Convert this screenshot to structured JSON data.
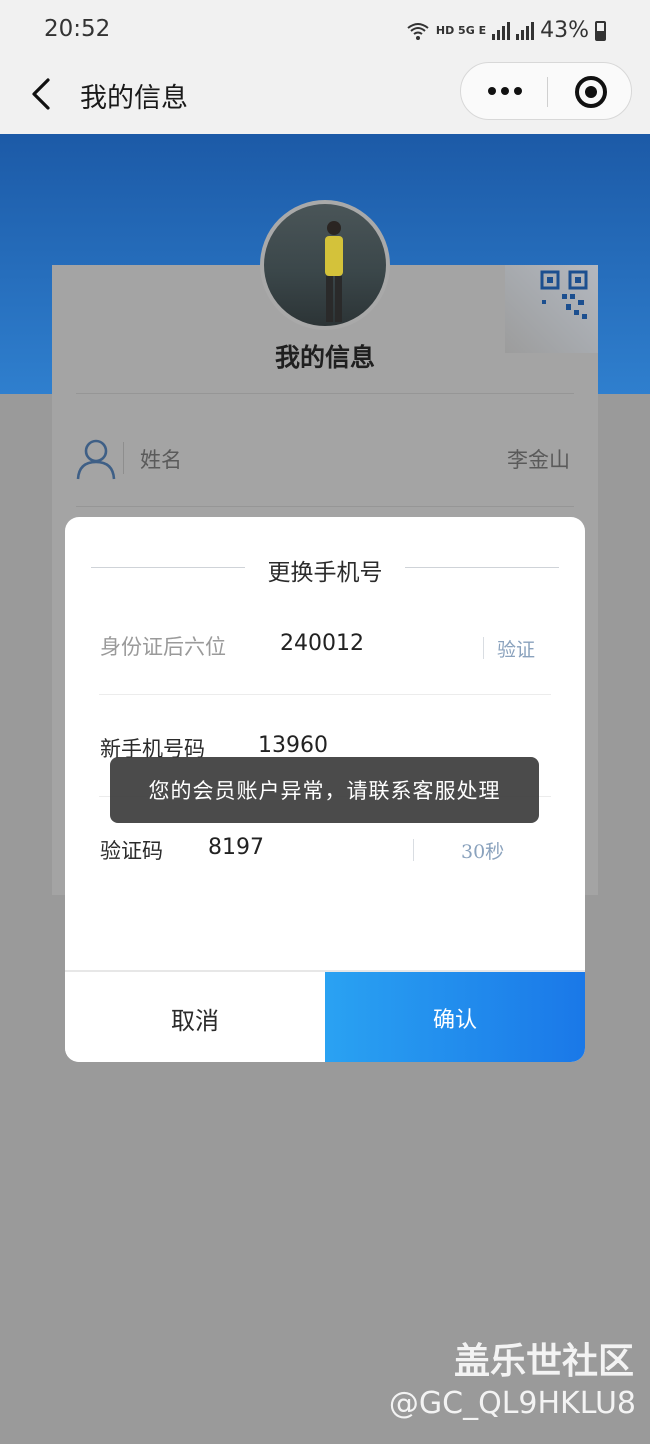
{
  "status_bar": {
    "time": "20:52",
    "network_labels": "HD 5G E",
    "battery": "43%"
  },
  "nav": {
    "title": "我的信息",
    "icons": [
      "back-arrow-icon",
      "more-dots-icon",
      "target-icon"
    ]
  },
  "profile_card": {
    "title": "我的信息",
    "name_label": "姓名",
    "name_value": "李金山",
    "banner_color": "#2f7fce"
  },
  "modal": {
    "title": "更换手机号",
    "id_label": "身份证后六位",
    "id_value": "240012",
    "verify_link": "验证",
    "phone_label": "新手机号码",
    "phone_value": "13960",
    "code_label": "验证码",
    "code_value": "8197",
    "countdown": "30秒",
    "cancel_label": "取消",
    "confirm_label": "确认",
    "accent_color": "#1a78e8"
  },
  "toast": {
    "message": "您的会员账户异常，请联系客服处理"
  },
  "watermark": {
    "brand": "盖乐世社区",
    "handle": "@GC_QL9HKLU8"
  }
}
